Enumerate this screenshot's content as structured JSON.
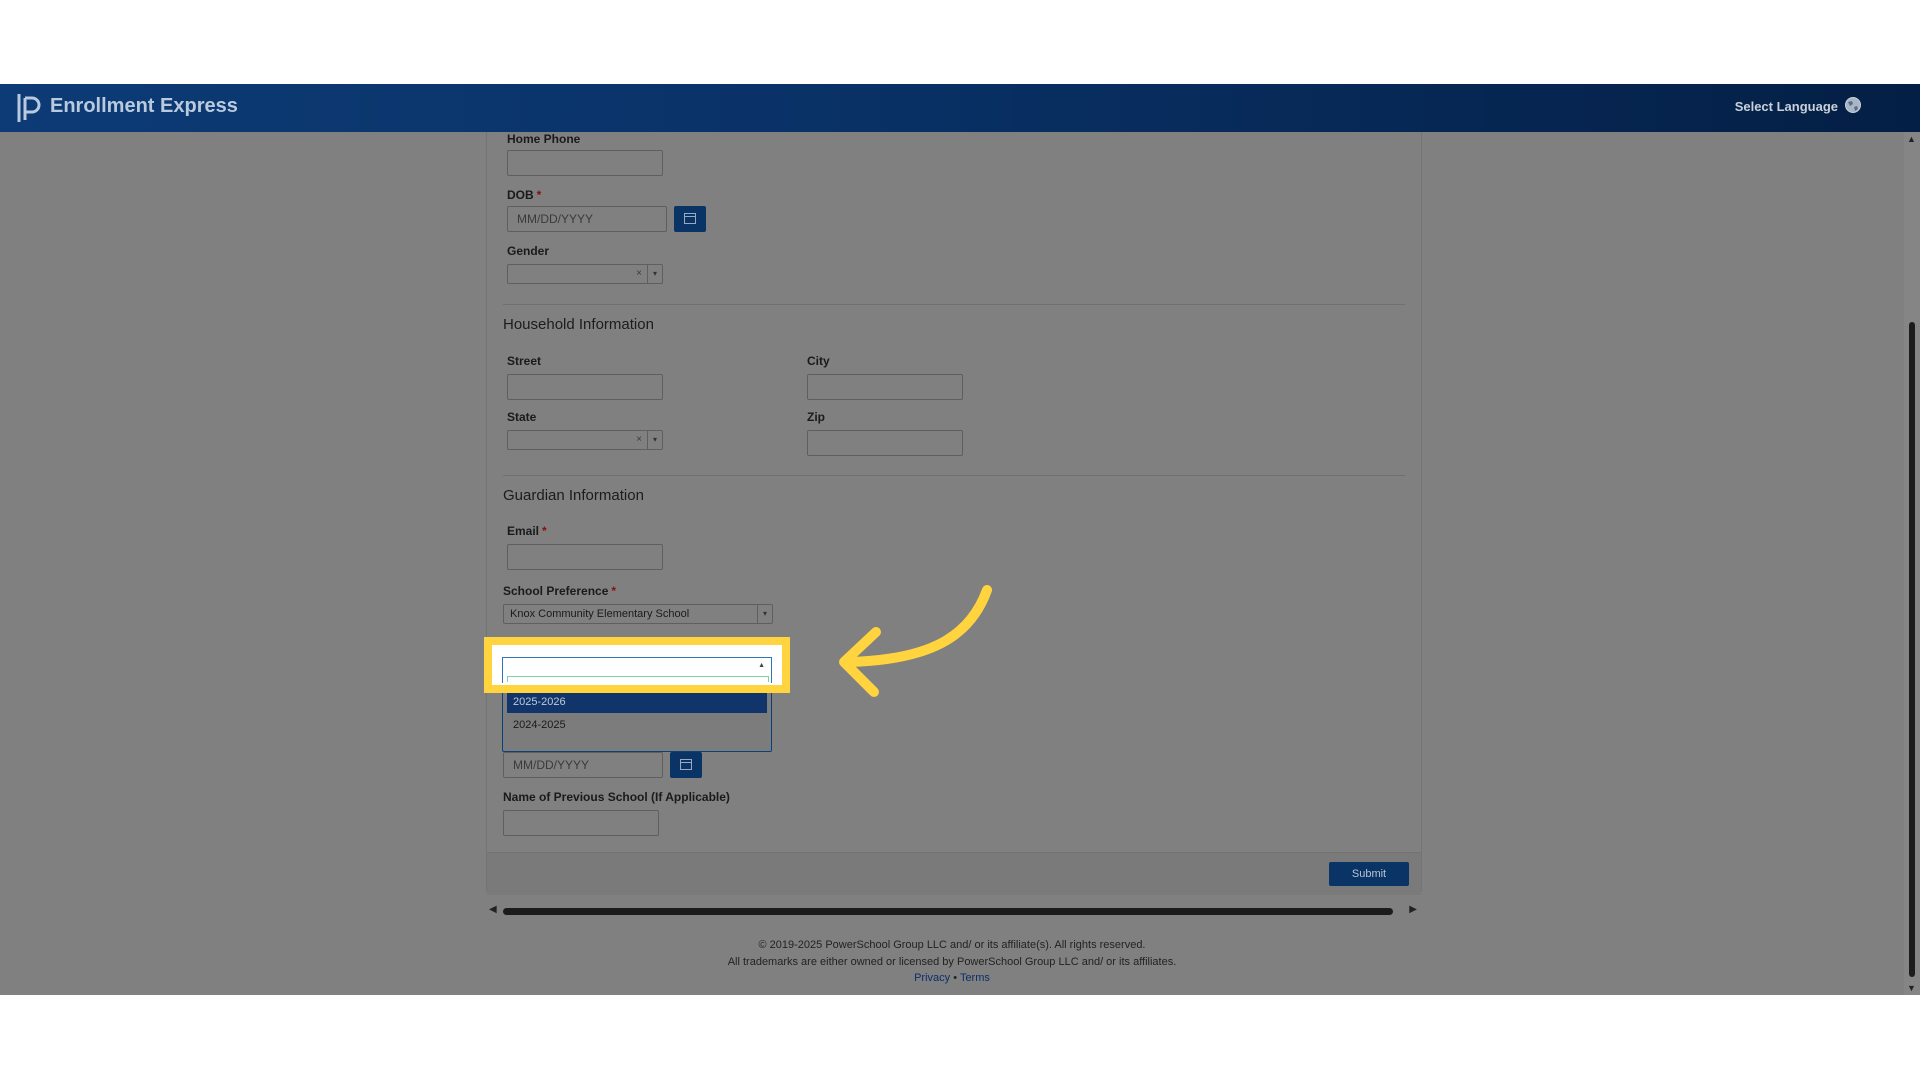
{
  "header": {
    "app_title": "Enrollment Express",
    "select_language": "Select Language"
  },
  "form": {
    "home_phone": {
      "label": "Home Phone",
      "value": ""
    },
    "dob": {
      "label": "DOB",
      "placeholder": "MM/DD/YYYY",
      "required_mark": "*"
    },
    "gender": {
      "label": "Gender",
      "value": "",
      "clear": "×"
    },
    "household": {
      "title": "Household Information",
      "street_label": "Street",
      "city_label": "City",
      "state_label": "State",
      "state_clear": "×",
      "zip_label": "Zip"
    },
    "guardian": {
      "title": "Guardian Information",
      "email_label": "Email",
      "required_mark": "*",
      "school_pref_label": "School Preference",
      "school_pref_value": "Knox Community Elementary School"
    },
    "school_year_dropdown": {
      "options": [
        "2025-2026",
        "2024-2025"
      ],
      "selected": "2025-2026"
    },
    "start_date": {
      "placeholder": "MM/DD/YYYY"
    },
    "previous_school": {
      "label": "Name of Previous School (If Applicable)"
    },
    "submit_label": "Submit"
  },
  "footer": {
    "copyright": "© 2019-2025 PowerSchool Group LLC and/ or its affiliate(s). All rights reserved.",
    "trademark": "All trademarks are either owned or licensed by PowerSchool Group LLC and/ or its affiliates.",
    "privacy": "Privacy",
    "separator": "•",
    "terms": "Terms"
  },
  "colors": {
    "header_blue": "#0d3b76",
    "button_blue": "#0a3466",
    "highlight_yellow": "#ffd43e",
    "required_red": "#8a0e0e"
  }
}
